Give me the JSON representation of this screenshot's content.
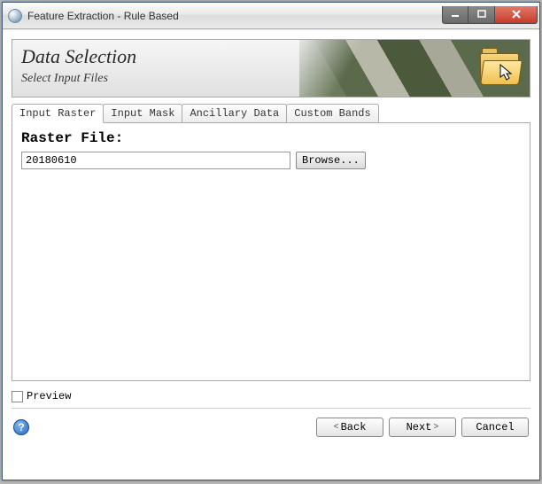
{
  "window": {
    "title": "Feature Extraction - Rule Based"
  },
  "banner": {
    "title": "Data Selection",
    "subtitle": "Select Input Files"
  },
  "tabs": [
    {
      "label": "Input Raster",
      "active": true
    },
    {
      "label": "Input Mask",
      "active": false
    },
    {
      "label": "Ancillary Data",
      "active": false
    },
    {
      "label": "Custom Bands",
      "active": false
    }
  ],
  "panel": {
    "raster_label": "Raster File:",
    "raster_value": "20180610",
    "browse_label": "Browse..."
  },
  "preview": {
    "label": "Preview",
    "checked": false
  },
  "footer": {
    "help_glyph": "?",
    "back_label": "Back",
    "next_label": "Next",
    "cancel_label": "Cancel"
  },
  "icons": {
    "folder": "folder-icon"
  }
}
